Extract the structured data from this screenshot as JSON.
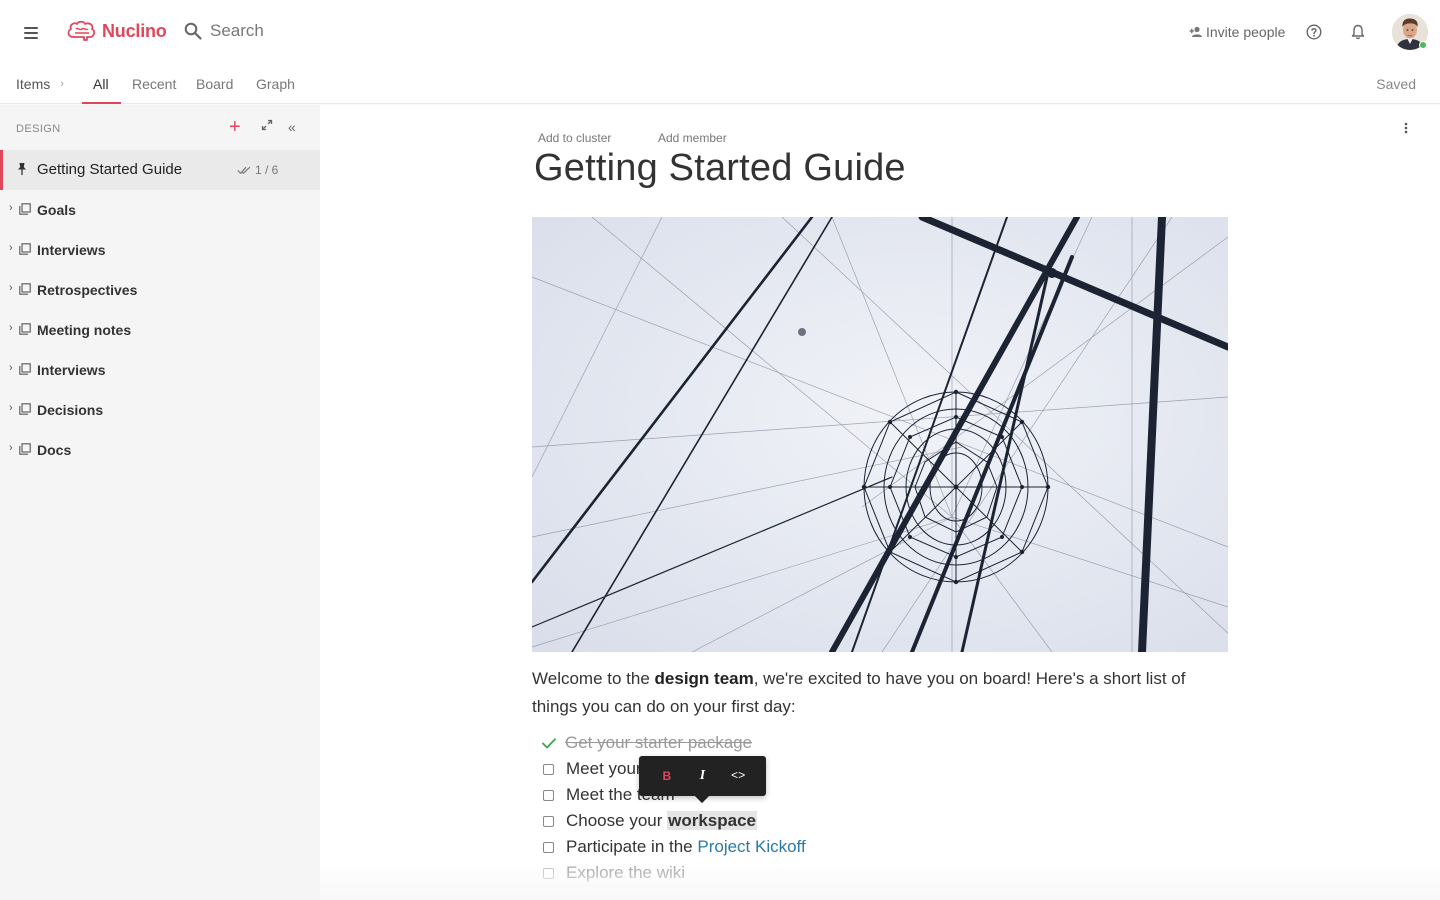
{
  "app": {
    "name": "Nuclino",
    "brand_color": "#e0475b"
  },
  "topbar": {
    "search_placeholder": "Search",
    "invite_label": "Invite people"
  },
  "tabsbar": {
    "breadcrumb": "Items",
    "tabs": [
      {
        "label": "All",
        "active": true
      },
      {
        "label": "Recent",
        "active": false
      },
      {
        "label": "Board",
        "active": false
      },
      {
        "label": "Graph",
        "active": false
      }
    ],
    "status": "Saved"
  },
  "sidebar": {
    "header": "DESIGN",
    "active_item": {
      "label": "Getting Started Guide",
      "progress": "1 / 6"
    },
    "items": [
      {
        "label": "Goals"
      },
      {
        "label": "Interviews"
      },
      {
        "label": "Retrospectives"
      },
      {
        "label": "Meeting notes"
      },
      {
        "label": "Interviews"
      },
      {
        "label": "Decisions"
      },
      {
        "label": "Docs"
      }
    ]
  },
  "document": {
    "add_to_cluster": "Add to cluster",
    "add_member": "Add member",
    "title": "Getting Started Guide",
    "intro_before": "Welcome to the ",
    "intro_bold": "design team",
    "intro_after": ", we're excited to have you on board! Here's a short list of things you can do on your first day:",
    "checklist": [
      {
        "label": "Get your starter package",
        "done": true
      },
      {
        "label": "Meet your",
        "done": false
      },
      {
        "label": "Meet the team",
        "done": false
      },
      {
        "label_before": "Choose your ",
        "label_highlight": "workspace",
        "done": false
      },
      {
        "label_before": "Participate in the ",
        "label_link": "Project Kickoff",
        "done": false
      },
      {
        "label": "Explore the wiki",
        "done": false
      }
    ]
  },
  "format_toolbar": {
    "bold": "B",
    "italic": "I",
    "code": "<>"
  }
}
